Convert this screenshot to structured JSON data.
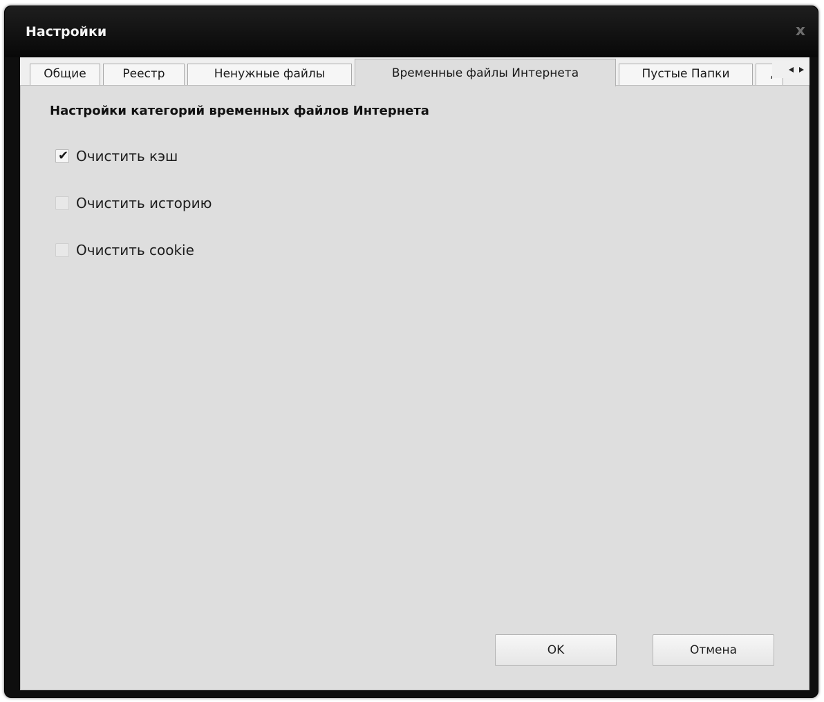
{
  "window": {
    "title": "Настройки",
    "close_glyph": "x"
  },
  "tabs": [
    {
      "label": "Общие",
      "active": false
    },
    {
      "label": "Реестр",
      "active": false
    },
    {
      "label": "Ненужные файлы",
      "active": false
    },
    {
      "label": "Временные файлы Интернета",
      "active": true
    },
    {
      "label": "Пустые Папки",
      "active": false
    },
    {
      "label": ",",
      "active": false
    }
  ],
  "panel": {
    "section_title": "Настройки категорий временных файлов Интернета",
    "options": [
      {
        "label": "Очистить кэш",
        "checked": true
      },
      {
        "label": "Очистить историю",
        "checked": false
      },
      {
        "label": "Очистить cookie",
        "checked": false
      }
    ]
  },
  "buttons": {
    "ok": "OK",
    "cancel": "Отмена"
  },
  "icons": {
    "close": "close-icon",
    "check": "checkmark-icon",
    "scroll_left": "arrow-left-icon",
    "scroll_right": "arrow-right-icon"
  }
}
